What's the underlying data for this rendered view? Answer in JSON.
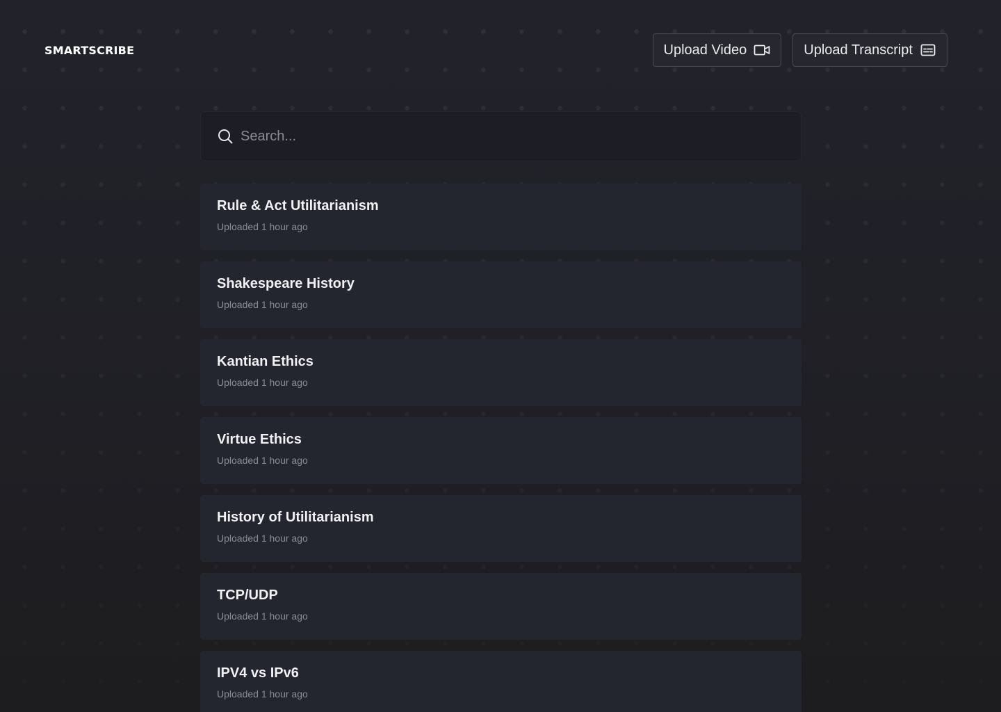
{
  "app": {
    "name": "SMARTSCRIBE"
  },
  "header": {
    "upload_video_label": "Upload Video",
    "upload_video_icon": "video-camera-icon",
    "upload_transcript_label": "Upload Transcript",
    "upload_transcript_icon": "captions-icon"
  },
  "search": {
    "placeholder": "Search...",
    "value": "",
    "icon": "search-icon"
  },
  "lectures": [
    {
      "title": "Rule & Act Utilitarianism",
      "uploaded": "Uploaded 1 hour ago"
    },
    {
      "title": "Shakespeare History",
      "uploaded": "Uploaded 1 hour ago"
    },
    {
      "title": "Kantian Ethics",
      "uploaded": "Uploaded 1 hour ago"
    },
    {
      "title": "Virtue Ethics",
      "uploaded": "Uploaded 1 hour ago"
    },
    {
      "title": "History of Utilitarianism",
      "uploaded": "Uploaded 1 hour ago"
    },
    {
      "title": "TCP/UDP",
      "uploaded": "Uploaded 1 hour ago"
    },
    {
      "title": "IPV4 vs IPv6",
      "uploaded": "Uploaded 1 hour ago"
    }
  ],
  "colors": {
    "background": "#22222b",
    "card": "#23252f",
    "search_bg": "#1d1d25",
    "button_border": "#4a4a52",
    "text_primary": "#f2f2f5",
    "text_secondary": "#8c8c96"
  }
}
